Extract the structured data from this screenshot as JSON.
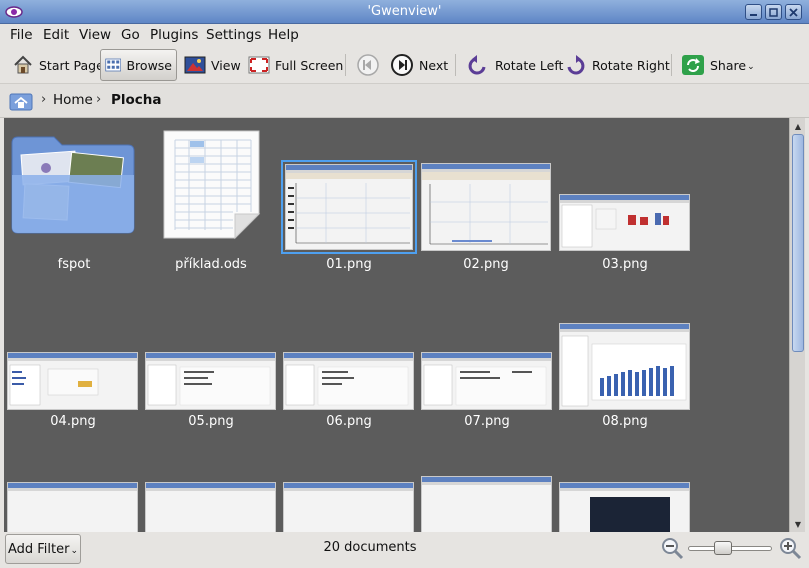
{
  "window": {
    "title": "'Gwenview'"
  },
  "menu": [
    "File",
    "Edit",
    "View",
    "Go",
    "Plugins",
    "Settings",
    "Help"
  ],
  "toolbar": {
    "start_page": "Start Page",
    "browse": "Browse",
    "view": "View",
    "full_screen": "Full Screen",
    "next": "Next",
    "rotate_left": "Rotate Left",
    "rotate_right": "Rotate Right",
    "share": "Share"
  },
  "breadcrumb": {
    "home": "Home",
    "current": "Plocha"
  },
  "items": [
    {
      "label": "fspot",
      "kind": "folder"
    },
    {
      "label": "příklad.ods",
      "kind": "spreadsheet"
    },
    {
      "label": "01.png",
      "kind": "image",
      "selected": true
    },
    {
      "label": "02.png",
      "kind": "image"
    },
    {
      "label": "03.png",
      "kind": "image"
    },
    {
      "label": "04.png",
      "kind": "image"
    },
    {
      "label": "05.png",
      "kind": "image"
    },
    {
      "label": "06.png",
      "kind": "image"
    },
    {
      "label": "07.png",
      "kind": "image"
    },
    {
      "label": "08.png",
      "kind": "image"
    }
  ],
  "status": {
    "add_filter": "Add Filter",
    "document_count": "20 documents"
  },
  "colors": {
    "browse_background": "#5c5c5c",
    "selection": "#4ea0f0",
    "title_bar": "#7a9bd2"
  }
}
